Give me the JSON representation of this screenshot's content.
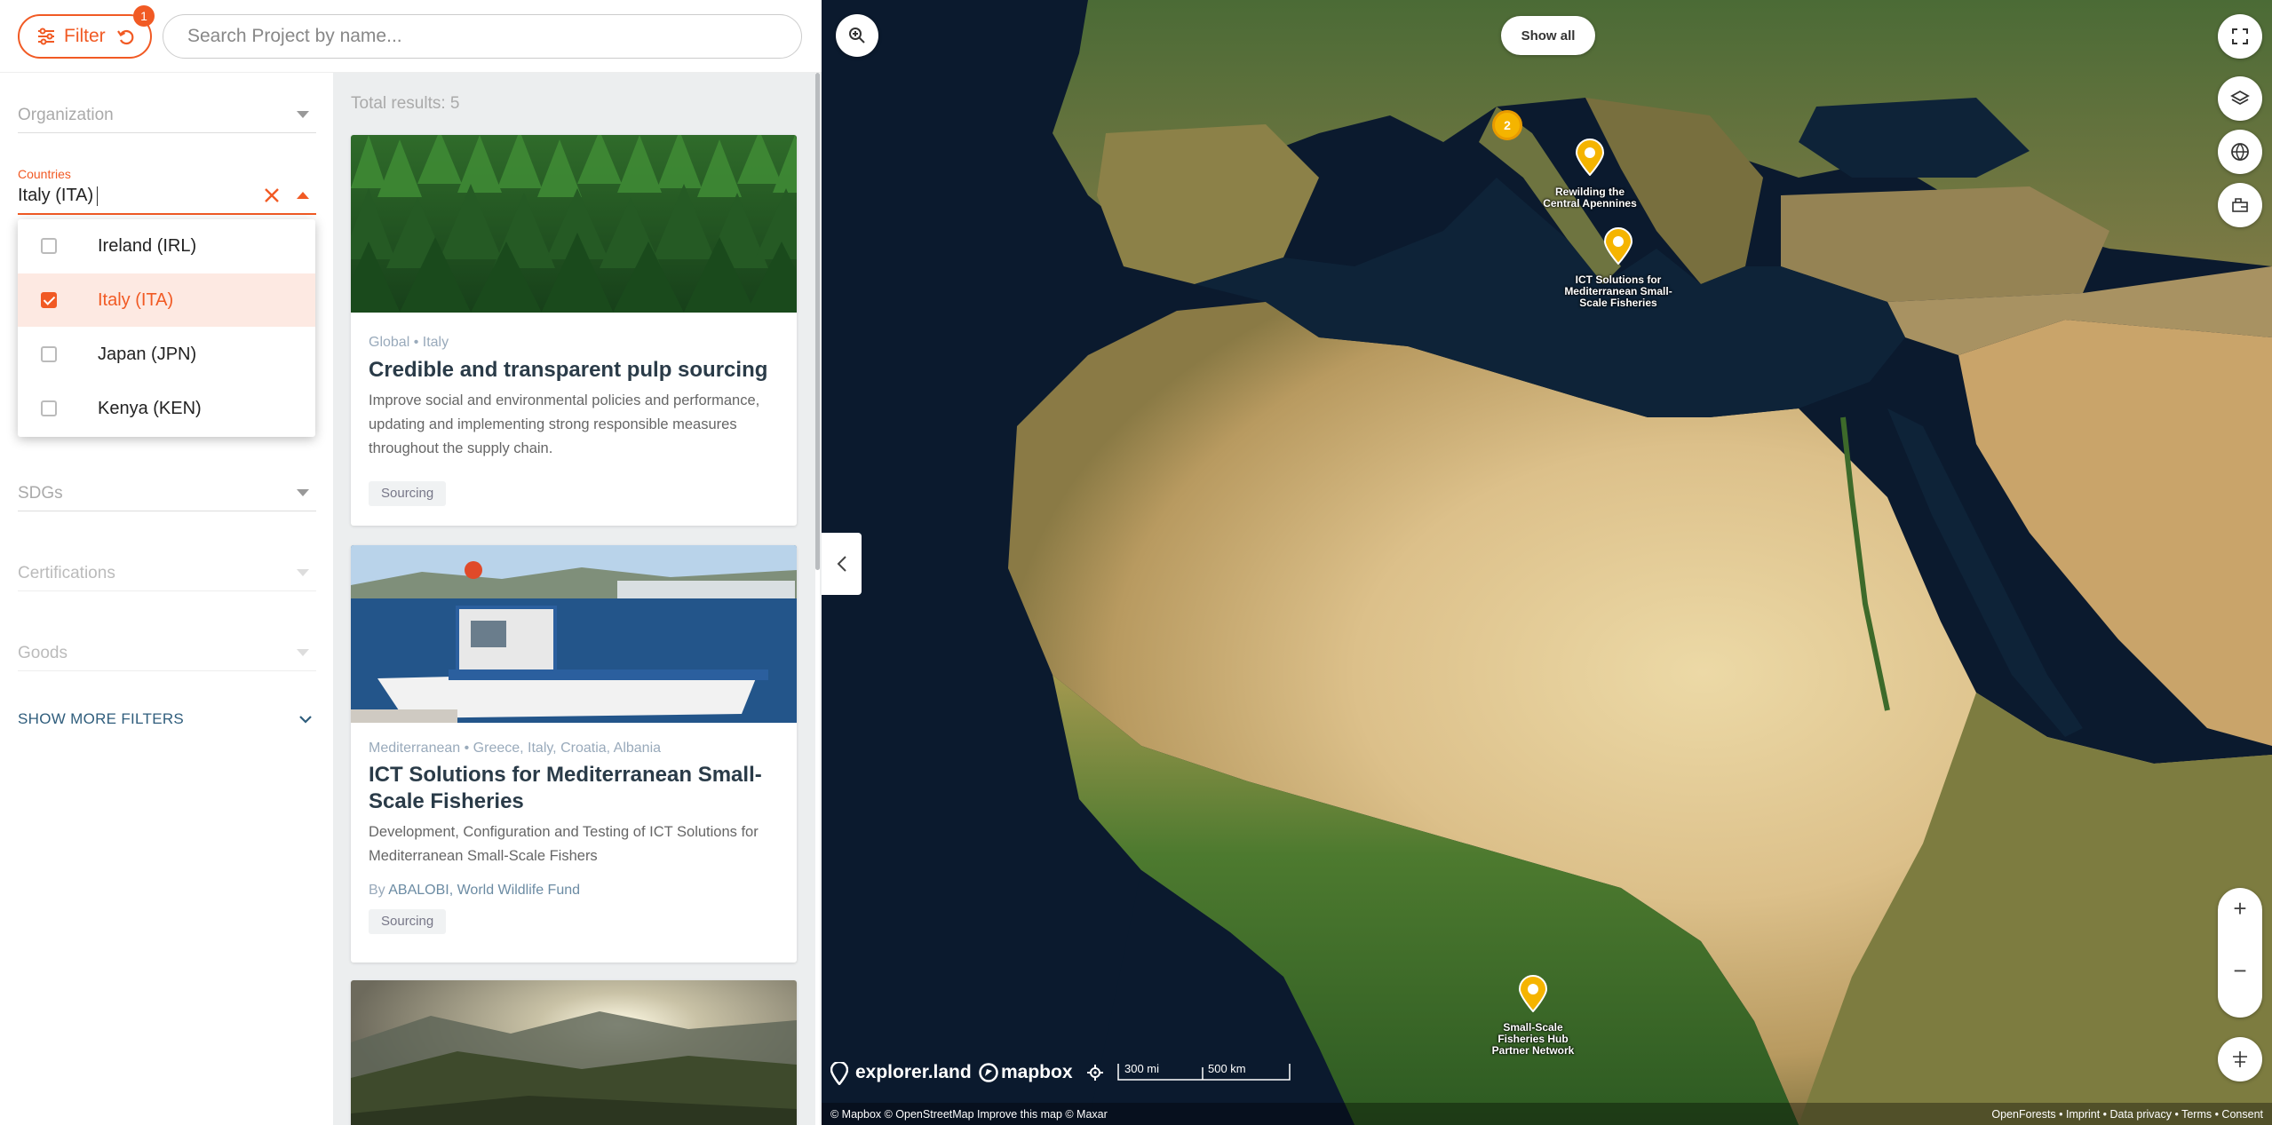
{
  "top": {
    "filter_label": "Filter",
    "filter_badge": "1",
    "search_placeholder": "Search Project by name..."
  },
  "filters": {
    "organization": "Organization",
    "countries_label": "Countries",
    "countries_value": "Italy (ITA)",
    "countries_options": [
      {
        "label": "Ireland (IRL)",
        "checked": false
      },
      {
        "label": "Italy (ITA)",
        "checked": true
      },
      {
        "label": "Japan (JPN)",
        "checked": false
      },
      {
        "label": "Kenya (KEN)",
        "checked": false
      }
    ],
    "sdgs": "SDGs",
    "certifications": "Certifications",
    "goods": "Goods",
    "show_more": "SHOW MORE FILTERS"
  },
  "results": {
    "total": "Total results: 5",
    "cards": [
      {
        "meta": "Global • Italy",
        "title": "Credible and transparent pulp sourcing",
        "desc": "Improve social and environmental policies and performance, updating and implementing strong responsible measures throughout the supply chain.",
        "tag": "Sourcing"
      },
      {
        "meta": "Mediterranean • Greece, Italy, Croatia, Albania",
        "title": "ICT Solutions for Mediterranean Small-Scale Fisheries",
        "desc": "Development, Configuration and Testing of ICT Solutions for Mediterranean Small-Scale Fishers",
        "by_prefix": "By",
        "by": "ABALOBI, World Wildlife Fund",
        "tag": "Sourcing"
      }
    ]
  },
  "map": {
    "show_all": "Show all",
    "cluster_count": "2",
    "pins": [
      {
        "label": "Rewilding the Central Apennines"
      },
      {
        "label": "ICT Solutions for Mediterranean Small-Scale Fisheries"
      },
      {
        "label": "Small-Scale Fisheries Hub Partner Network"
      }
    ],
    "brand1": "explorer.land",
    "brand2": "mapbox",
    "scale_mi": "300 mi",
    "scale_km": "500 km",
    "zoom_in": "+",
    "zoom_out": "−",
    "attribution_left": "© Mapbox © OpenStreetMap Improve this map © Maxar",
    "attribution_right": "OpenForests  •  Imprint  •  Data privacy  •  Terms  •  Consent"
  },
  "colors": {
    "accent": "#f15a24",
    "title": "#2a3b48",
    "pin": "#f5b400"
  }
}
